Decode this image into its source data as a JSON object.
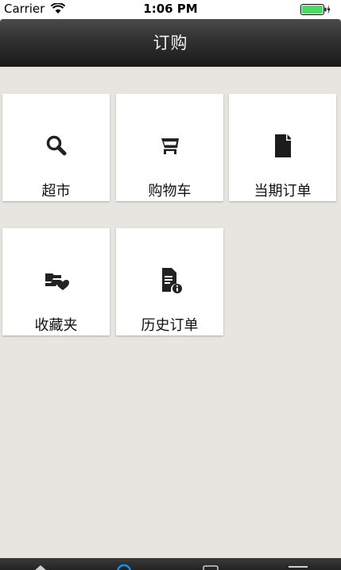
{
  "status_bar": {
    "carrier": "Carrier",
    "time": "1:06 PM",
    "battery_color": "#4cd964"
  },
  "nav": {
    "title": "订购"
  },
  "tiles": [
    {
      "label": "超市",
      "icon": "search-icon"
    },
    {
      "label": "购物车",
      "icon": "shopping-cart-icon"
    },
    {
      "label": "当期订单",
      "icon": "document-icon"
    },
    {
      "label": "收藏夹",
      "icon": "favorites-folder-icon"
    },
    {
      "label": "历史订单",
      "icon": "document-info-icon"
    }
  ],
  "tab_bar": {
    "icons": [
      "home-icon",
      "info-icon",
      "tablet-icon",
      "menu-icon"
    ]
  }
}
